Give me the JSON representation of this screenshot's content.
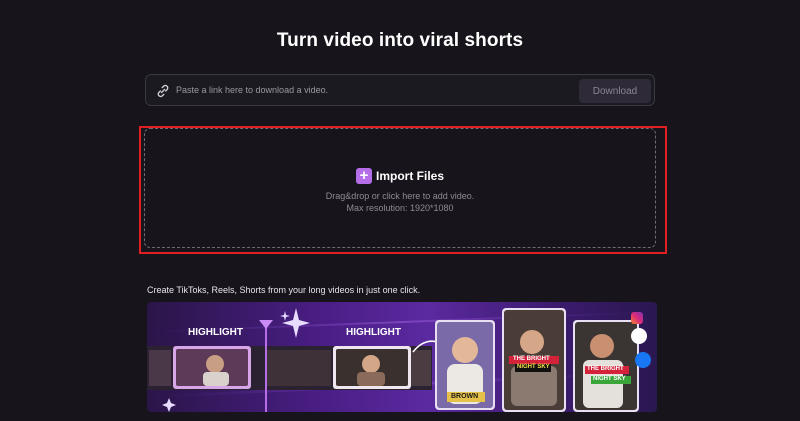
{
  "page": {
    "title": "Turn video into viral shorts"
  },
  "link_bar": {
    "placeholder": "Paste a link here to download a video.",
    "download_label": "Download",
    "icon": "link-icon"
  },
  "import": {
    "label": "Import Files",
    "hint": "Drag&drop or click here to add video.",
    "max_resolution": "Max resolution: 1920*1080",
    "icon": "plus-icon"
  },
  "promo": {
    "tagline": "Create TikToks, Reels, Shorts from your long videos in just one click.",
    "highlight_1": "HIGHLIGHT",
    "highlight_2": "HIGHLIGHT",
    "caption_brown": "BROWN",
    "caption_a": "THE BRIGHT",
    "caption_b": "NIGHT SKY",
    "caption_c": "THE BRIGHT",
    "caption_d": "NIGHT SKY",
    "social_icons": [
      "instagram-icon",
      "tiktok-icon",
      "facebook-icon"
    ]
  },
  "colors": {
    "background": "#17151b",
    "accent": "#b66ee8",
    "highlight_border": "#e02020",
    "download_button": "#2f2a38"
  }
}
